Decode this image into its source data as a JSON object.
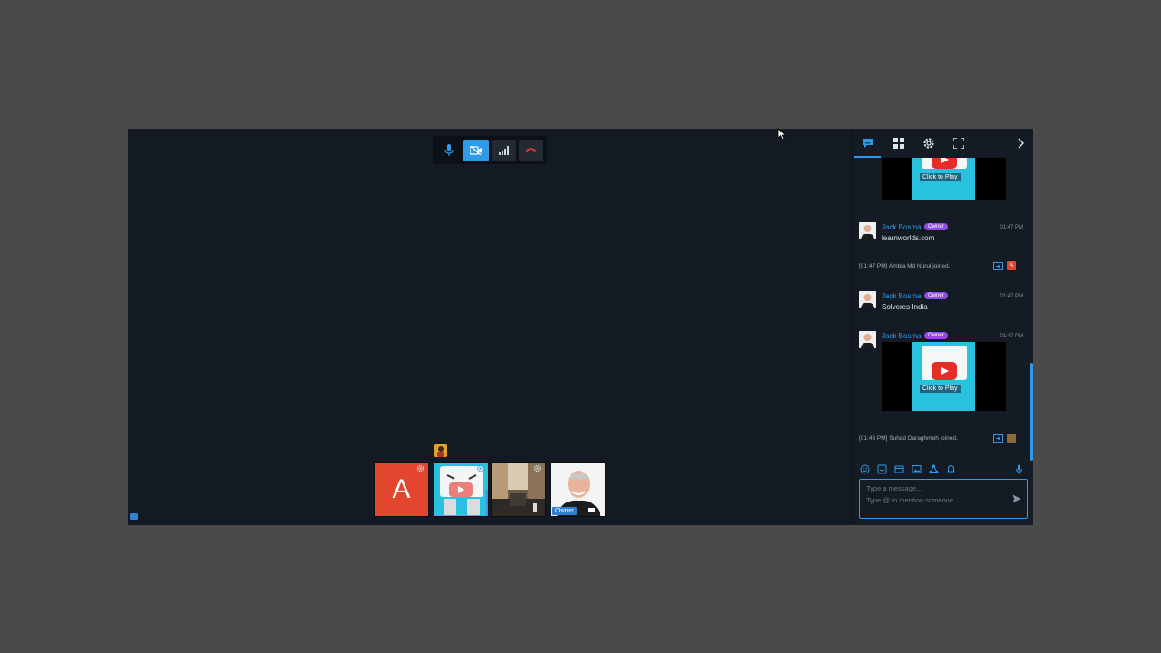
{
  "controls": {
    "mic": "mic-icon",
    "camera_off": "camera-off-icon",
    "signal": "signal-icon",
    "hangup": "hangup-icon",
    "accent": "#2f9ae8",
    "danger": "#e53935"
  },
  "participants": [
    {
      "type": "letter",
      "letter": "A",
      "color": "#e2462f"
    },
    {
      "type": "video",
      "name": "youtube-robot"
    },
    {
      "type": "video",
      "name": "street-scene"
    },
    {
      "type": "video",
      "name": "owner-face",
      "tag": "Owner"
    }
  ],
  "sidebar": {
    "tabs": [
      "chat-icon",
      "grid-icon",
      "gear-icon",
      "fullscreen-icon",
      "chevron-right-icon"
    ]
  },
  "chat": {
    "video_top": {
      "cta": "Click to Play"
    },
    "messages": [
      {
        "name": "Jack Bosma",
        "badge": "Owner",
        "time": "01:47 PM",
        "text": "learnworlds.com"
      },
      {
        "system": "[01:47 PM] Ambia Md Nurul joined.",
        "initial": "A"
      },
      {
        "name": "Jack Bosma",
        "badge": "Owner",
        "time": "01:47 PM",
        "text": "Solveres India"
      },
      {
        "name": "Jack Bosma",
        "badge": "Owner",
        "time": "01:47 PM",
        "video_cta": "Click to Play"
      },
      {
        "system": "[01:48 PM] Suhad Daraghmeh joined."
      }
    ]
  },
  "composer": {
    "placeholder_line1": "Type a message...",
    "placeholder_line2": "Type @ to mention someone."
  }
}
